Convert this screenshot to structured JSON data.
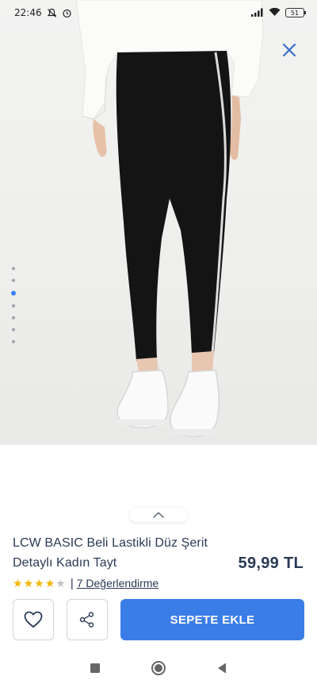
{
  "status_bar": {
    "time": "22:46",
    "icons": [
      "mute-bell-icon",
      "alarm-icon",
      "signal-icon",
      "wifi-icon"
    ],
    "battery": "51"
  },
  "product_image": {
    "description_icon": "product-photo",
    "dots_total": 7,
    "active_dot": 2,
    "colors": {
      "active_dot": "#3b82f6",
      "close_icon": "#3b6fd0"
    }
  },
  "product": {
    "title": "LCW BASIC Beli Lastikli Düz Şerit Detaylı Kadın Tayt",
    "price": "59,99 TL",
    "rating": {
      "full_stars": 4,
      "total_stars": 5,
      "separator": "|",
      "reviews_label": "7 Değerlendirme"
    }
  },
  "actions": {
    "favorite_icon": "heart-icon",
    "share_icon": "share-icon",
    "add_to_cart_label": "SEPETE EKLE",
    "colors": {
      "add_to_cart_bg": "#3b7de6"
    }
  },
  "nav_bar": {
    "icons": [
      "recent-apps-icon",
      "home-icon",
      "back-icon"
    ]
  }
}
